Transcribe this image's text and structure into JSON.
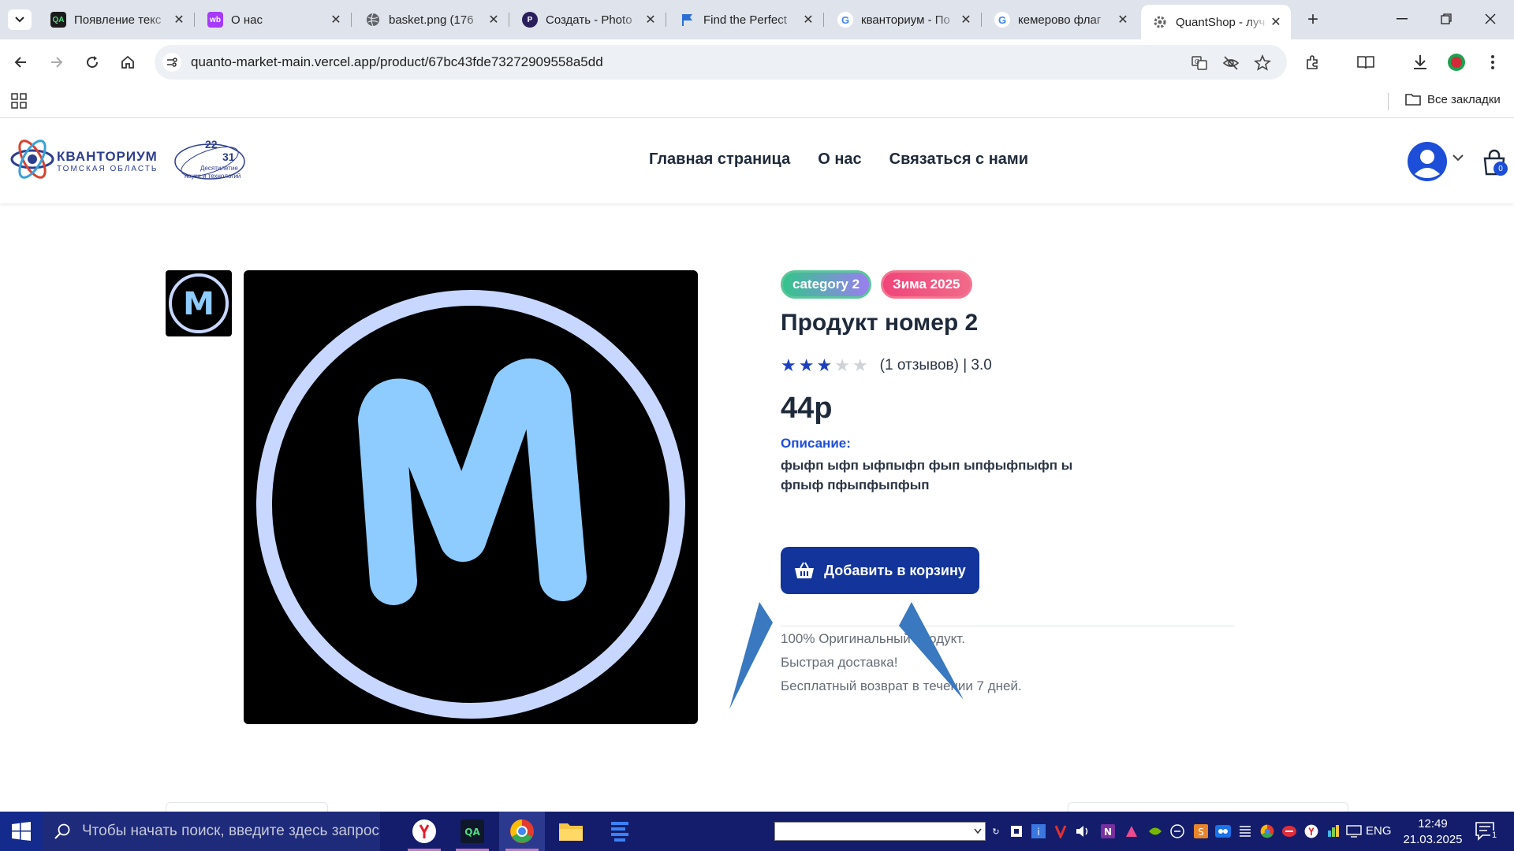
{
  "browser": {
    "tabs": [
      {
        "title": "Появление текс",
        "favicon": "qa",
        "active": false
      },
      {
        "title": "О нас",
        "favicon": "wb",
        "active": false
      },
      {
        "title": "basket.png (176",
        "favicon": "globe",
        "active": false
      },
      {
        "title": "Создать - Photo",
        "favicon": "photoroom",
        "active": false
      },
      {
        "title": "Find the Perfect",
        "favicon": "flag",
        "active": false
      },
      {
        "title": "кванториум - По",
        "favicon": "google",
        "active": false
      },
      {
        "title": "кемерово флаг",
        "favicon": "google",
        "active": false
      },
      {
        "title": "QuantShop - луч",
        "favicon": "gear",
        "active": true
      }
    ],
    "url": "quanto-market-main.vercel.app/product/67bc43fde73272909558a5dd",
    "bookmarks_all_label": "Все закладки"
  },
  "site": {
    "logo": {
      "name": "КВАНТОРИУМ",
      "subtitle": "ТОМСКАЯ ОБЛАСТЬ",
      "badge_num1": "22",
      "badge_num2": "31",
      "badge_text1": "Десятилетие",
      "badge_text2": "науки и технологий"
    },
    "nav": [
      "Главная страница",
      "О нас",
      "Связаться с нами"
    ],
    "cart_count": "0"
  },
  "product": {
    "tags": [
      "category 2",
      "Зима 2025"
    ],
    "title": "Продукт номер 2",
    "rating": 3,
    "rating_max": 5,
    "reviews_text": "(1 отзывов) | 3.0",
    "price": "44р",
    "description_label": "Описание:",
    "description": "фыфп ыфп ыфпыфп фып ыпфыфпыфп ы фпыф пфыпфыпфып",
    "add_to_cart_label": "Добавить в корзину",
    "perks": [
      "100% Оригинальный продукт.",
      "Быстрая доставка!",
      "Бесплатный возврат в течении 7 дней."
    ],
    "image_letter": "M"
  },
  "taskbar": {
    "search_placeholder": "Чтобы начать поиск, введите здесь запрос",
    "lang": "ENG",
    "time": "12:49",
    "date": "21.03.2025",
    "notification_count": "1"
  },
  "colors": {
    "primary": "#12349b",
    "link": "#1d4ed8",
    "tag_category": "#34c48c",
    "tag_season": "#f0457a"
  }
}
